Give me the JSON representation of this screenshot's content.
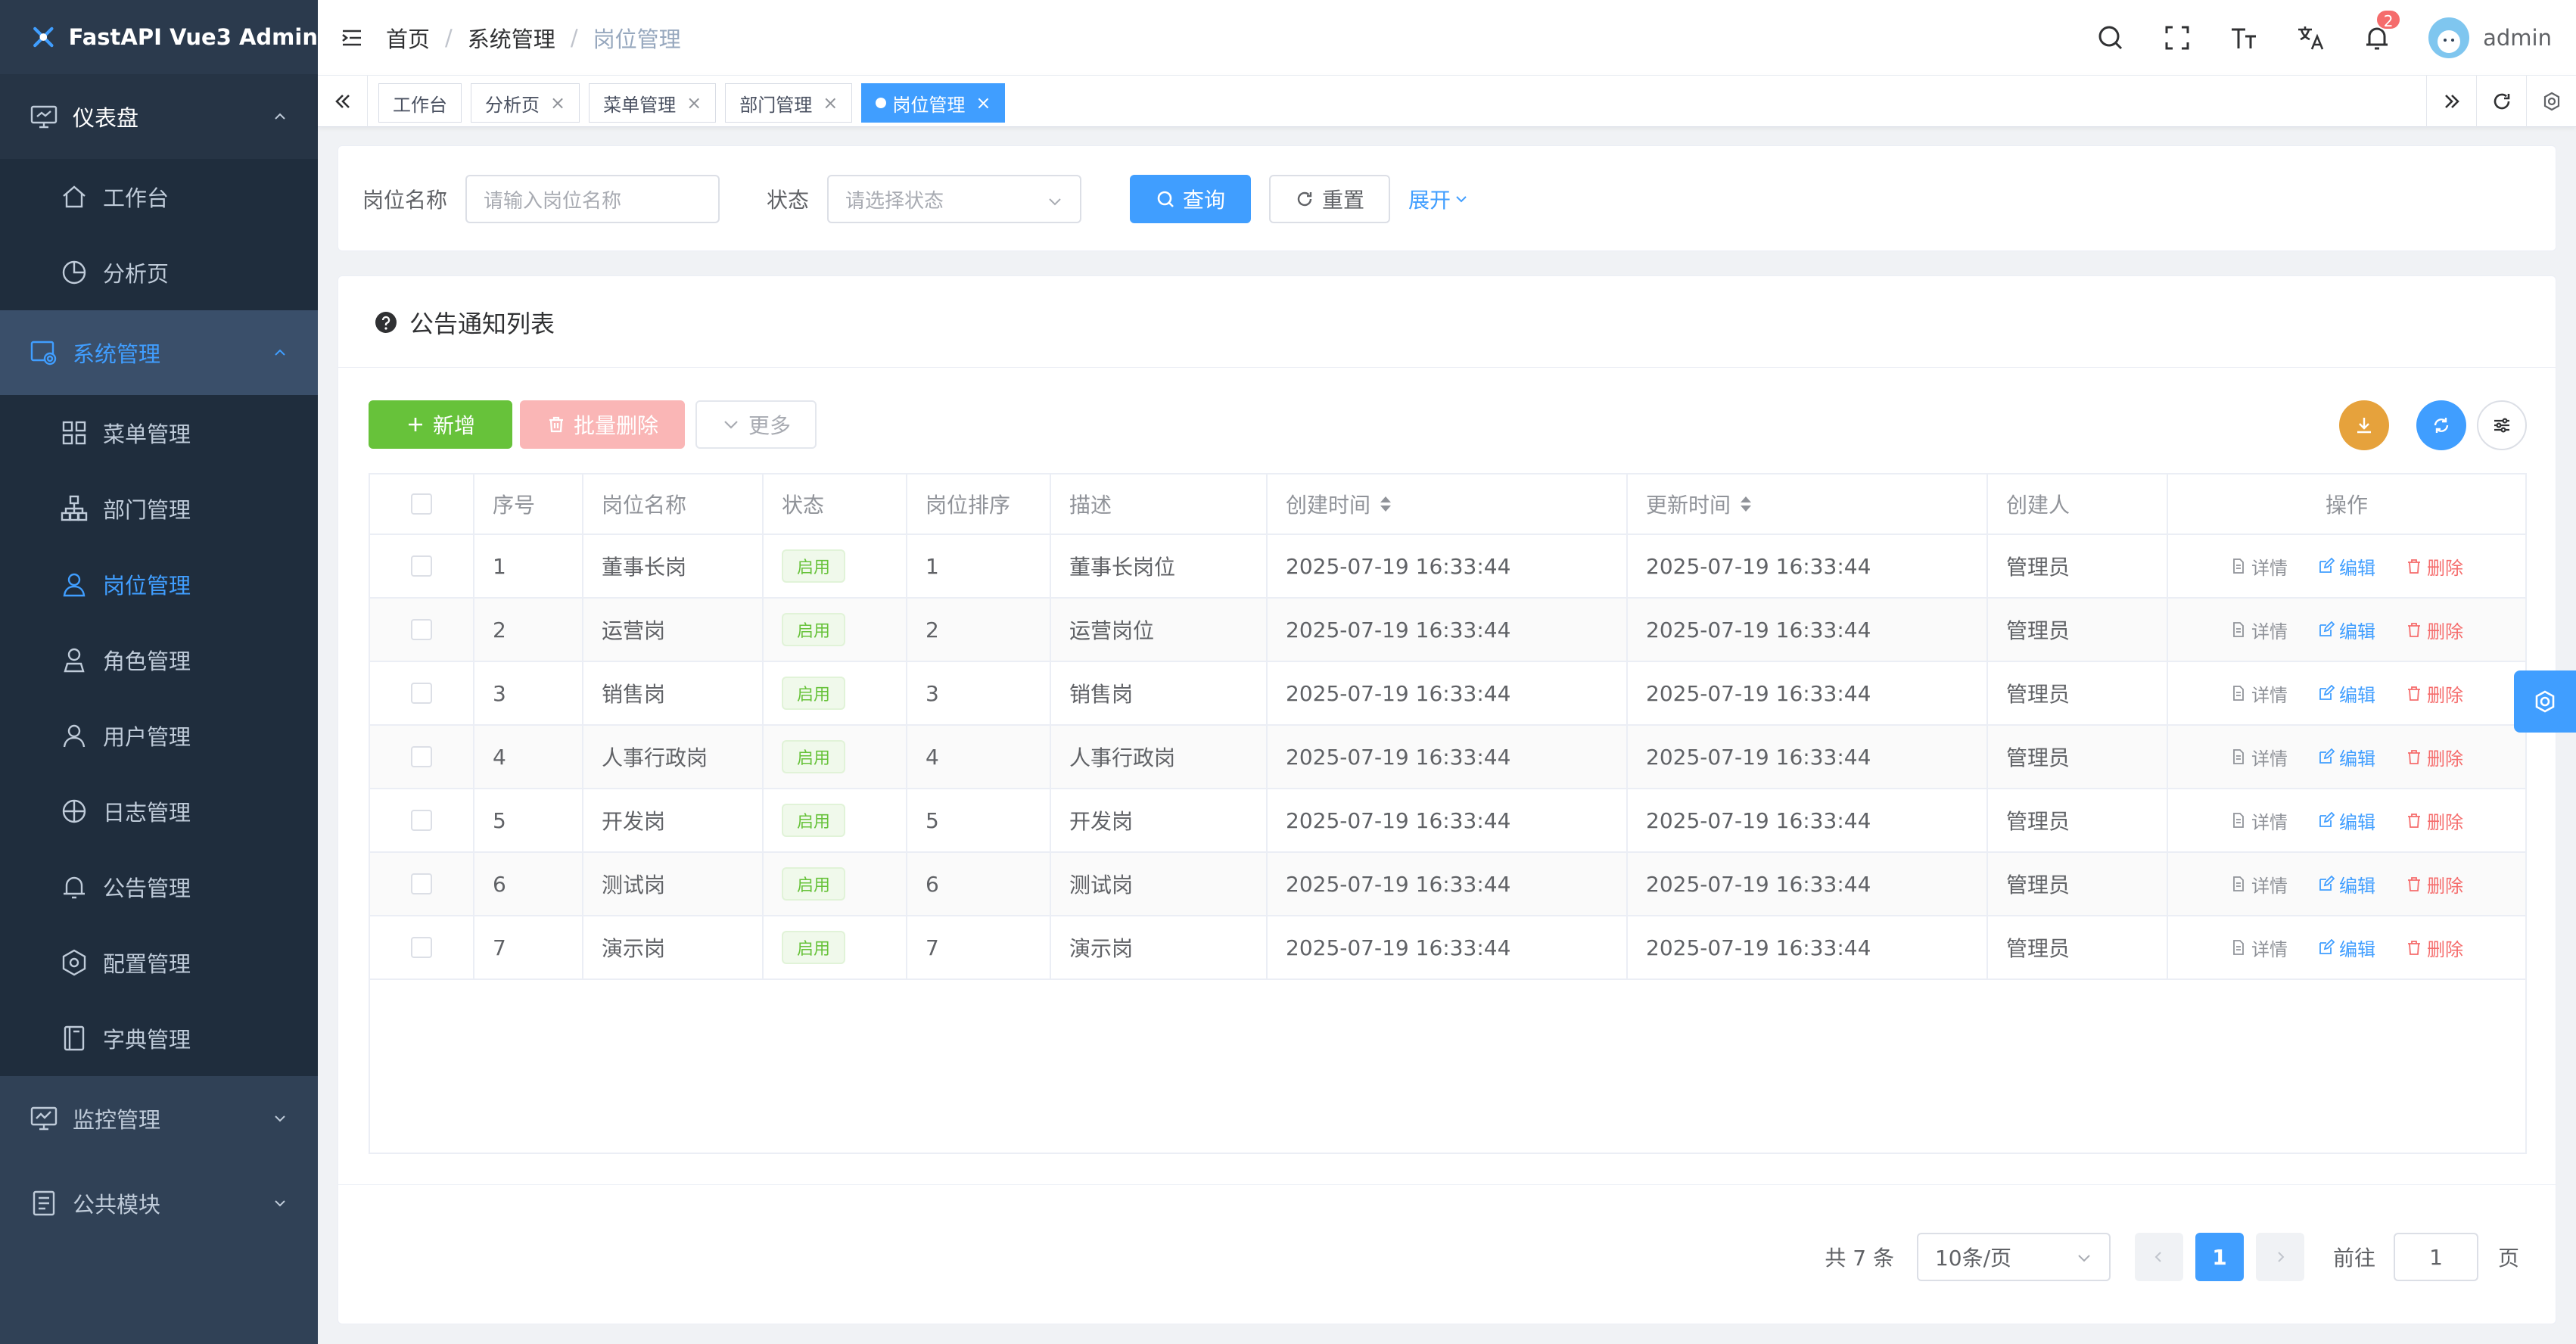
{
  "app": {
    "title": "FastAPI Vue3 Admin"
  },
  "sidebar": {
    "groups": [
      {
        "label": "仪表盘",
        "icon": "dashboard-icon",
        "expanded": true,
        "items": [
          {
            "label": "工作台",
            "icon": "home-icon"
          },
          {
            "label": "分析页",
            "icon": "pie-chart-icon"
          }
        ]
      },
      {
        "label": "系统管理",
        "icon": "system-icon",
        "expanded": true,
        "items": [
          {
            "label": "菜单管理",
            "icon": "grid-icon"
          },
          {
            "label": "部门管理",
            "icon": "org-icon"
          },
          {
            "label": "岗位管理",
            "icon": "user-icon",
            "current": true
          },
          {
            "label": "角色管理",
            "icon": "role-icon"
          },
          {
            "label": "用户管理",
            "icon": "user-icon"
          },
          {
            "label": "日志管理",
            "icon": "log-icon"
          },
          {
            "label": "公告管理",
            "icon": "bell-icon"
          },
          {
            "label": "配置管理",
            "icon": "hex-gear-icon"
          },
          {
            "label": "字典管理",
            "icon": "book-icon"
          }
        ]
      },
      {
        "label": "监控管理",
        "icon": "monitor-icon",
        "expanded": false
      },
      {
        "label": "公共模块",
        "icon": "module-icon",
        "expanded": false
      }
    ]
  },
  "header": {
    "breadcrumb": [
      "首页",
      "系统管理",
      "岗位管理"
    ],
    "notification_count": "2",
    "user_name": "admin"
  },
  "tags": {
    "items": [
      {
        "label": "工作台",
        "closable": false,
        "active": false
      },
      {
        "label": "分析页",
        "closable": true,
        "active": false
      },
      {
        "label": "菜单管理",
        "closable": true,
        "active": false
      },
      {
        "label": "部门管理",
        "closable": true,
        "active": false
      },
      {
        "label": "岗位管理",
        "closable": true,
        "active": true
      }
    ],
    "close_glyph": "×"
  },
  "search": {
    "name_label": "岗位名称",
    "name_placeholder": "请输入岗位名称",
    "status_label": "状态",
    "status_placeholder": "请选择状态",
    "query_label": "查询",
    "reset_label": "重置",
    "expand_label": "展开"
  },
  "table_card": {
    "title": "公告通知列表",
    "add_label": "新增",
    "batch_delete_label": "批量删除",
    "more_label": "更多",
    "columns": [
      "序号",
      "岗位名称",
      "状态",
      "岗位排序",
      "描述",
      "创建时间",
      "更新时间",
      "创建人",
      "操作"
    ],
    "rows": [
      {
        "index": "1",
        "name": "董事长岗",
        "status": "启用",
        "order": "1",
        "desc": "董事长岗位",
        "created": "2025-07-19 16:33:44",
        "updated": "2025-07-19 16:33:44",
        "creator": "管理员"
      },
      {
        "index": "2",
        "name": "运营岗",
        "status": "启用",
        "order": "2",
        "desc": "运营岗位",
        "created": "2025-07-19 16:33:44",
        "updated": "2025-07-19 16:33:44",
        "creator": "管理员"
      },
      {
        "index": "3",
        "name": "销售岗",
        "status": "启用",
        "order": "3",
        "desc": "销售岗",
        "created": "2025-07-19 16:33:44",
        "updated": "2025-07-19 16:33:44",
        "creator": "管理员"
      },
      {
        "index": "4",
        "name": "人事行政岗",
        "status": "启用",
        "order": "4",
        "desc": "人事行政岗",
        "created": "2025-07-19 16:33:44",
        "updated": "2025-07-19 16:33:44",
        "creator": "管理员"
      },
      {
        "index": "5",
        "name": "开发岗",
        "status": "启用",
        "order": "5",
        "desc": "开发岗",
        "created": "2025-07-19 16:33:44",
        "updated": "2025-07-19 16:33:44",
        "creator": "管理员"
      },
      {
        "index": "6",
        "name": "测试岗",
        "status": "启用",
        "order": "6",
        "desc": "测试岗",
        "created": "2025-07-19 16:33:44",
        "updated": "2025-07-19 16:33:44",
        "creator": "管理员"
      },
      {
        "index": "7",
        "name": "演示岗",
        "status": "启用",
        "order": "7",
        "desc": "演示岗",
        "created": "2025-07-19 16:33:44",
        "updated": "2025-07-19 16:33:44",
        "creator": "管理员"
      }
    ],
    "actions": {
      "detail": "详情",
      "edit": "编辑",
      "delete": "删除"
    }
  },
  "pagination": {
    "total_text": "共 7 条",
    "page_size": "10条/页",
    "current_page": "1",
    "goto_label": "前往",
    "goto_value": "1",
    "page_suffix": "页"
  },
  "colors": {
    "sidebar_bg": "#304156",
    "primary": "#409eff",
    "success": "#67c23a",
    "danger": "#f56c6c",
    "warning": "#e6a23c"
  }
}
